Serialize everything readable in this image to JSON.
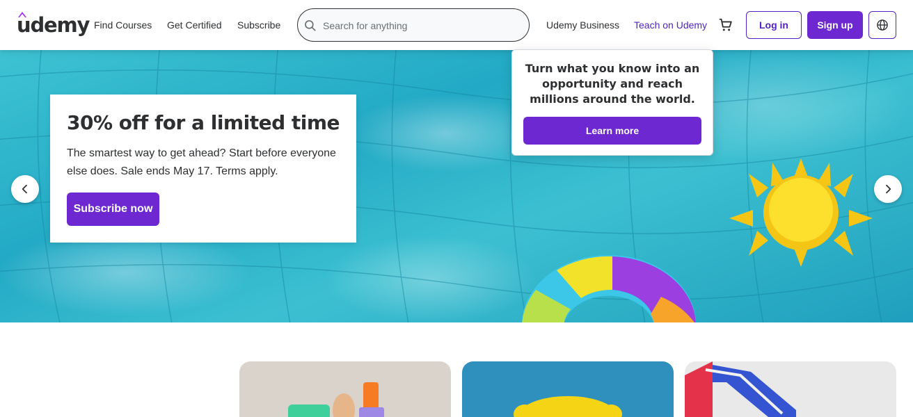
{
  "header": {
    "logo_text": "udemy",
    "nav": {
      "find_courses": "Find Courses",
      "get_certified": "Get Certified",
      "subscribe": "Subscribe",
      "udemy_business": "Udemy Business",
      "teach": "Teach on Udemy"
    },
    "search": {
      "placeholder": "Search for anything"
    },
    "login_label": "Log in",
    "signup_label": "Sign up"
  },
  "hero": {
    "title": "30% off for a limited time",
    "text": "The smartest way to get ahead? Start before everyone else does. Sale ends May 17. Terms apply.",
    "cta": "Subscribe now"
  },
  "teach_popover": {
    "text": "Turn what you know into an opportunity and reach millions around the world.",
    "button": "Learn more"
  },
  "icons": {
    "search": "search-icon",
    "cart": "cart-icon",
    "language": "globe-icon",
    "prev": "chevron-left-icon",
    "next": "chevron-right-icon"
  },
  "colors": {
    "brand": "#6d28d2",
    "brand_dark": "#5022c3",
    "text": "#2d2f31",
    "pool": "#2bb3cb"
  }
}
